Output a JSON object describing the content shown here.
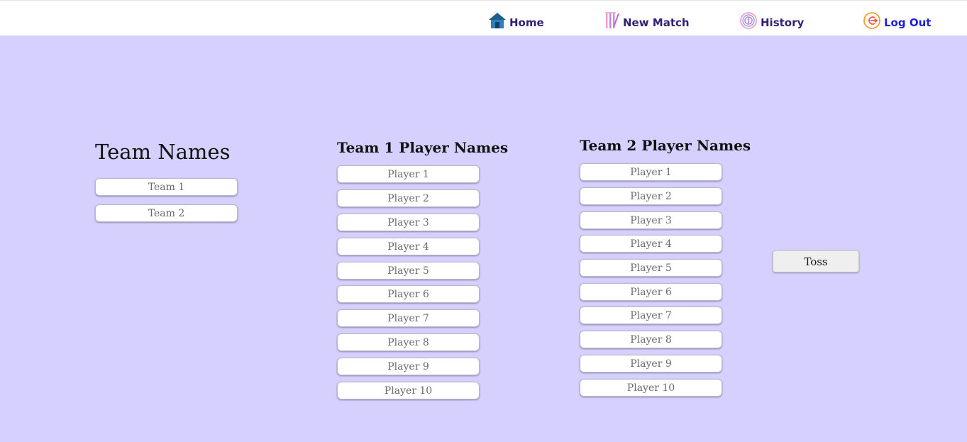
{
  "nav": {
    "home_label": "Home",
    "new_match_label": "New Match",
    "history_label": "History",
    "logout_label": "Log Out",
    "icons": {
      "home": "home-icon",
      "new_match": "cricket-stumps-icon",
      "history": "history-icon",
      "logout": "logout-icon"
    }
  },
  "teams": {
    "heading": "Team Names",
    "placeholders": [
      "Team 1",
      "Team 2"
    ]
  },
  "team1": {
    "heading": "Team 1 Player Names",
    "placeholders": [
      "Player 1",
      "Player 2",
      "Player 3",
      "Player 4",
      "Player 5",
      "Player 6",
      "Player 7",
      "Player 8",
      "Player 9",
      "Player 10"
    ]
  },
  "team2": {
    "heading": "Team 2 Player Names",
    "placeholders": [
      "Player 1",
      "Player 2",
      "Player 3",
      "Player 4",
      "Player 5",
      "Player 6",
      "Player 7",
      "Player 8",
      "Player 9",
      "Player 10"
    ]
  },
  "toss_label": "Toss",
  "colors": {
    "page_background": "#d6d0ff",
    "nav_text": "#33207a",
    "logout_text": "#1d20d9"
  }
}
